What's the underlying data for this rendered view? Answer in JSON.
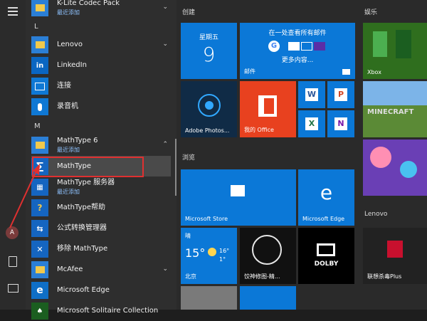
{
  "app_list": {
    "top_item": {
      "label": "K-Lite Codec Pack",
      "sub": "最近添加"
    },
    "letter_l": "L",
    "items_l": [
      {
        "label": "Lenovo"
      },
      {
        "label": "LinkedIn"
      },
      {
        "label": "连接"
      },
      {
        "label": "录音机"
      }
    ],
    "letter_m": "M",
    "mathtype_folder": {
      "label": "MathType 6",
      "sub": "最近添加"
    },
    "mathtype_children": [
      {
        "label": "MathType"
      },
      {
        "label": "MathType 服务器",
        "sub": "最近添加"
      },
      {
        "label": "MathType帮助"
      },
      {
        "label": "公式转换管理器"
      },
      {
        "label": "移除 MathType"
      }
    ],
    "items_m2": [
      {
        "label": "McAfee"
      },
      {
        "label": "Microsoft Edge"
      },
      {
        "label": "Microsoft Solitaire Collection"
      }
    ]
  },
  "user_avatar_letter": "A",
  "tiles": {
    "group_create": "创建",
    "group_play": "娱乐",
    "group_browse": "浏览",
    "group_lenovo": "Lenovo",
    "calendar": {
      "weekday": "星期五",
      "day": "9"
    },
    "mail": {
      "title": "在一处查看所有邮件",
      "more": "更多内容...",
      "caption": "邮件"
    },
    "photoshop": {
      "caption": "Adobe Photos..."
    },
    "office": {
      "caption": "我的 Office"
    },
    "xbox": {
      "caption": "Xbox"
    },
    "minecraft": {
      "caption": "MINECRAFT"
    },
    "store": {
      "caption": "Microsoft Store"
    },
    "edge": {
      "caption": "Microsoft Edge"
    },
    "weather": {
      "condition": "晴",
      "temp": "15°",
      "high": "16°",
      "low": "1°",
      "city": "北京"
    },
    "news": {
      "caption": "饺神修图-精..."
    },
    "dolby": {
      "caption": "DOLBY"
    },
    "mcafee": {
      "caption": "联想杀毒Plus"
    }
  }
}
